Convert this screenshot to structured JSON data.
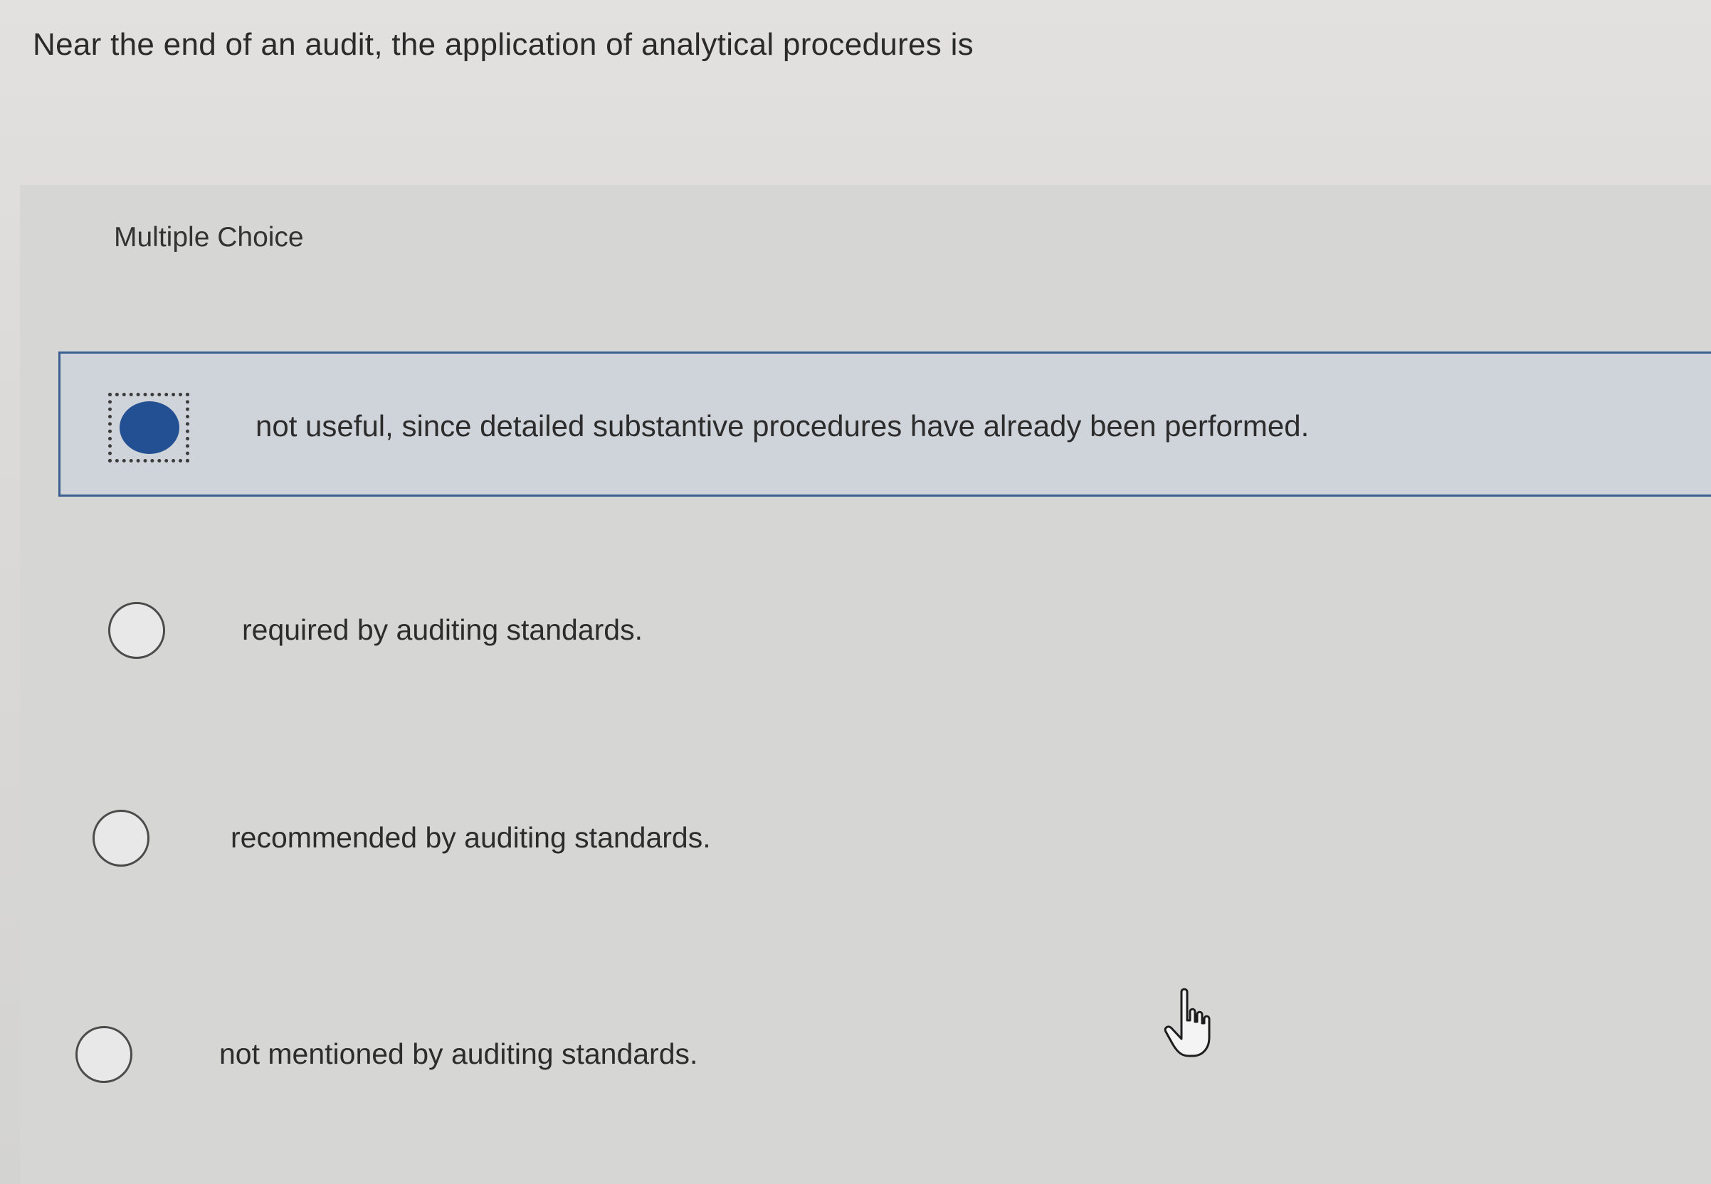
{
  "question": {
    "text": "Near the end of an audit, the application of analytical procedures is"
  },
  "question_type": "Multiple Choice",
  "options": [
    {
      "label": "not useful, since detailed substantive procedures have already been performed.",
      "selected": true
    },
    {
      "label": "required by auditing standards.",
      "selected": false
    },
    {
      "label": "recommended by auditing standards.",
      "selected": false
    },
    {
      "label": "not mentioned by auditing standards.",
      "selected": false
    }
  ],
  "colors": {
    "accent": "#234f93",
    "selected_border": "#3c5f92",
    "selected_background": "#cfd4da"
  },
  "icons": {
    "cursor": "hand-pointer-icon"
  }
}
